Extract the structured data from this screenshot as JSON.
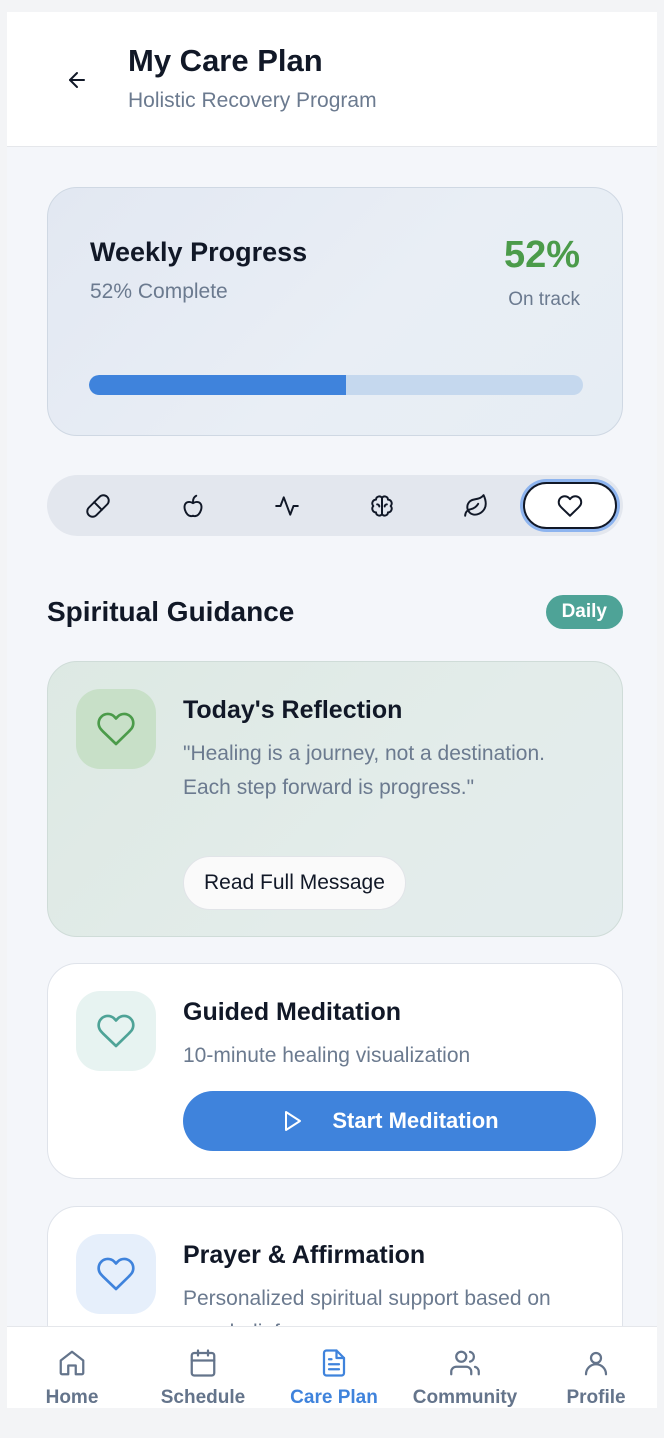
{
  "header": {
    "title": "My Care Plan",
    "subtitle": "Holistic Recovery Program"
  },
  "progress": {
    "title": "Weekly Progress",
    "complete_text": "52% Complete",
    "percent_label": "52%",
    "status": "On track",
    "value": 0.52
  },
  "tabs": [
    {
      "icon": "pill-icon"
    },
    {
      "icon": "apple-icon"
    },
    {
      "icon": "activity-icon"
    },
    {
      "icon": "brain-icon"
    },
    {
      "icon": "leaf-icon"
    },
    {
      "icon": "heart-icon",
      "active": true
    }
  ],
  "section": {
    "title": "Spiritual Guidance",
    "badge": "Daily"
  },
  "cards": {
    "reflection": {
      "title": "Today's Reflection",
      "text": "\"Healing is a journey, not a destination. Each step forward is progress.\"",
      "button": "Read Full Message"
    },
    "meditation": {
      "title": "Guided Meditation",
      "text": "10-minute healing visualization",
      "button": "Start Meditation"
    },
    "prayer": {
      "title": "Prayer & Affirmation",
      "text": "Personalized spiritual support based on your beliefs"
    }
  },
  "nav": {
    "items": [
      {
        "label": "Home",
        "icon": "home-icon"
      },
      {
        "label": "Schedule",
        "icon": "calendar-icon"
      },
      {
        "label": "Care Plan",
        "icon": "document-icon",
        "active": true
      },
      {
        "label": "Community",
        "icon": "users-icon"
      },
      {
        "label": "Profile",
        "icon": "user-icon"
      }
    ]
  },
  "colors": {
    "accent": "#3f83dc",
    "success": "#4b9b4a",
    "badge": "#4ea397",
    "muted": "#6b7a8f"
  }
}
